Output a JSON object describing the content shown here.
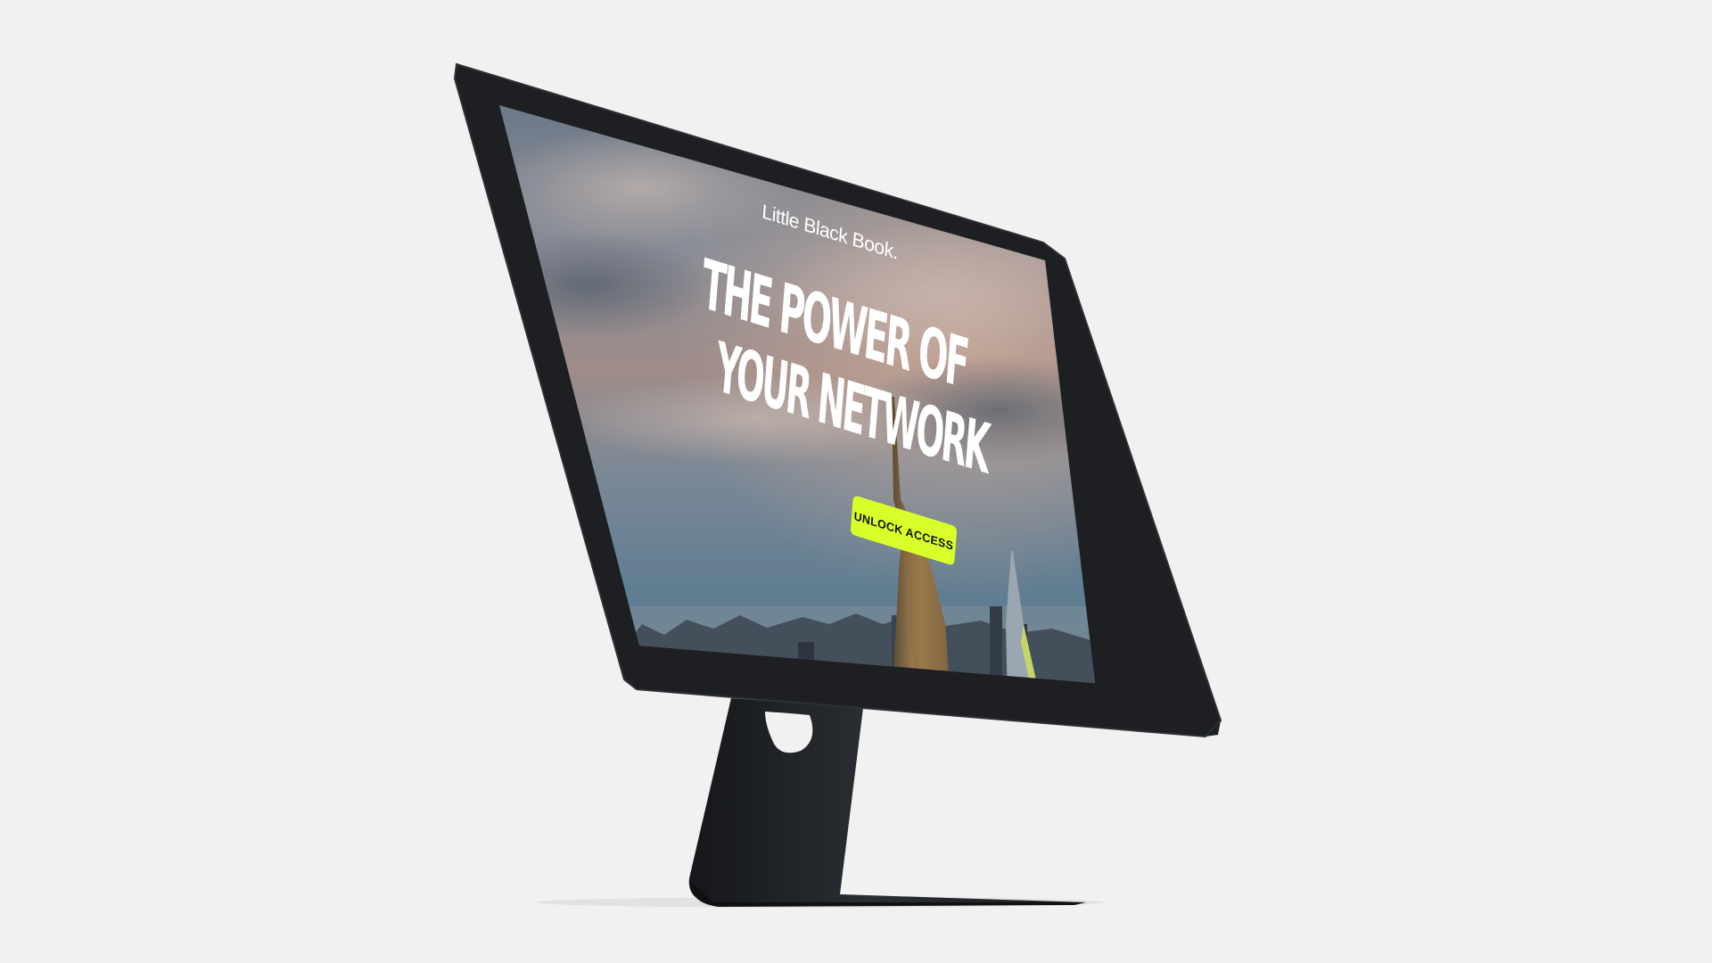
{
  "page": {
    "brand": "Little Black Book.",
    "headline": {
      "line1": "THE POWER OF",
      "line2": "YOUR NETWORK"
    },
    "cta_label": "UNLOCK ACCESS"
  },
  "colors": {
    "background": "#f1f1f1",
    "monitor": "#1d1f22",
    "cta": "#d8ff2a",
    "headline": "#ffffff"
  },
  "icons": {
    "brand_mark": "little-black-book-wordmark",
    "monitor": "desktop-monitor"
  }
}
